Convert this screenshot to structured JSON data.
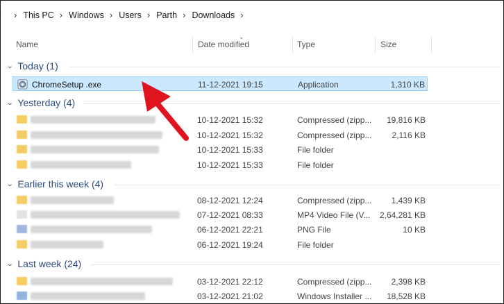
{
  "breadcrumb": [
    "This PC",
    "Windows",
    "Users",
    "Parth",
    "Downloads"
  ],
  "columns": {
    "name": "Name",
    "date": "Date modified",
    "type": "Type",
    "size": "Size"
  },
  "groups": [
    {
      "label": "Today (1)",
      "rows": [
        {
          "name": "ChromeSetup .exe",
          "date": "11-12-2021 19:15",
          "type": "Application",
          "size": "1,310 KB",
          "icon": "application-icon",
          "selected": true
        }
      ]
    },
    {
      "label": "Yesterday (4)",
      "rows": [
        {
          "name": "",
          "date": "10-12-2021 15:32",
          "type": "Compressed (zipp...",
          "size": "19,816 KB",
          "icon": "zip-folder-icon"
        },
        {
          "name": "",
          "date": "10-12-2021 15:32",
          "type": "Compressed (zipp...",
          "size": "2,116 KB",
          "icon": "zip-folder-icon"
        },
        {
          "name": "",
          "date": "10-12-2021 15:33",
          "type": "File folder",
          "size": "",
          "icon": "folder-icon"
        },
        {
          "name": "",
          "date": "10-12-2021 15:33",
          "type": "File folder",
          "size": "",
          "icon": "folder-icon"
        }
      ]
    },
    {
      "label": "Earlier this week (4)",
      "rows": [
        {
          "name": "",
          "date": "08-12-2021 12:24",
          "type": "Compressed (zipp...",
          "size": "1,439 KB",
          "icon": "zip-folder-icon"
        },
        {
          "name": "",
          "date": "07-12-2021 08:33",
          "type": "MP4 Video File (V...",
          "size": "2,64,281 KB",
          "icon": "video-file-icon"
        },
        {
          "name": "",
          "date": "06-12-2021 22:21",
          "type": "PNG File",
          "size": "10 KB",
          "icon": "image-file-icon"
        },
        {
          "name": "",
          "date": "06-12-2021 19:24",
          "type": "File folder",
          "size": "",
          "icon": "folder-icon"
        }
      ]
    },
    {
      "label": "Last week (24)",
      "rows": [
        {
          "name": "",
          "date": "03-12-2021 22:12",
          "type": "Compressed (zipp...",
          "size": "2,398 KB",
          "icon": "zip-folder-icon"
        },
        {
          "name": "",
          "date": "03-12-2021 21:02",
          "type": "Windows Installer ...",
          "size": "18,528 KB",
          "icon": "installer-icon"
        }
      ]
    }
  ],
  "colors": {
    "selection": "#cce8ff",
    "selection_border": "#99d1ff",
    "group_text": "#2b4c7e",
    "arrow": "#e0141e"
  }
}
